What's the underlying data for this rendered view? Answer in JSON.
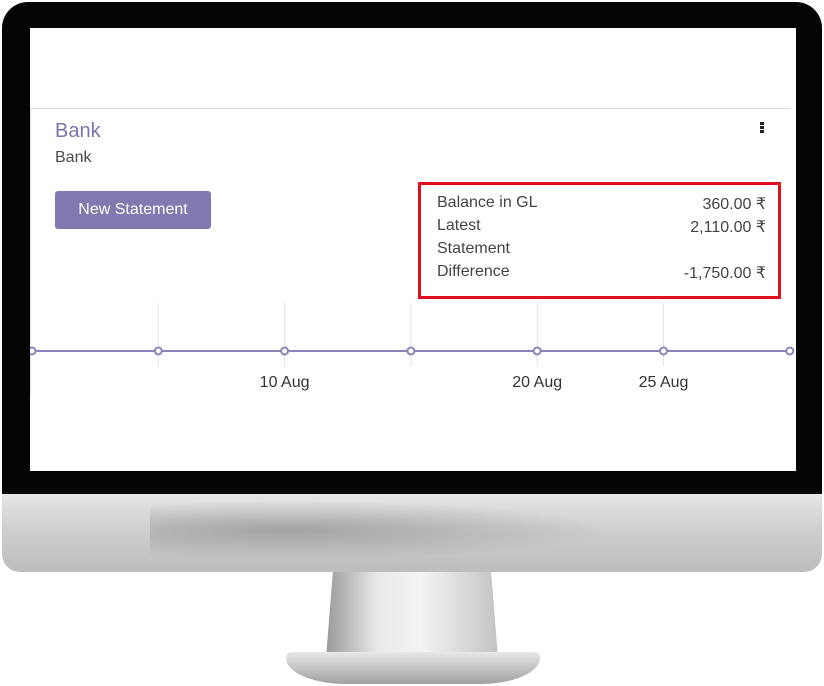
{
  "journal": {
    "title": "Bank",
    "subtitle": "Bank",
    "new_statement_label": "New Statement"
  },
  "summary": {
    "rows": [
      {
        "label": "Balance in GL",
        "value": "360.00 ₹"
      },
      {
        "label": "Latest",
        "value": "2,110.00 ₹"
      },
      {
        "label": "Statement",
        "value": ""
      },
      {
        "label": "Difference",
        "value": "-1,750.00 ₹"
      }
    ]
  },
  "colors": {
    "accent": "#7c73ad",
    "button": "#8179b0",
    "highlight_box": "#e0101e",
    "line": "#8a84b8"
  },
  "icons": {
    "menu": "kebab-menu-icon"
  },
  "chart_data": {
    "type": "line",
    "x": [
      "",
      "",
      "10 Aug",
      "",
      "20 Aug",
      "25 Aug",
      ""
    ],
    "tick_labels": [
      "10 Aug",
      "20 Aug",
      "25 Aug"
    ],
    "series": [
      {
        "values": [
          0,
          0,
          0,
          0,
          0,
          0,
          0
        ]
      }
    ],
    "xlabel": "",
    "ylabel": "",
    "grid": true,
    "title": ""
  }
}
